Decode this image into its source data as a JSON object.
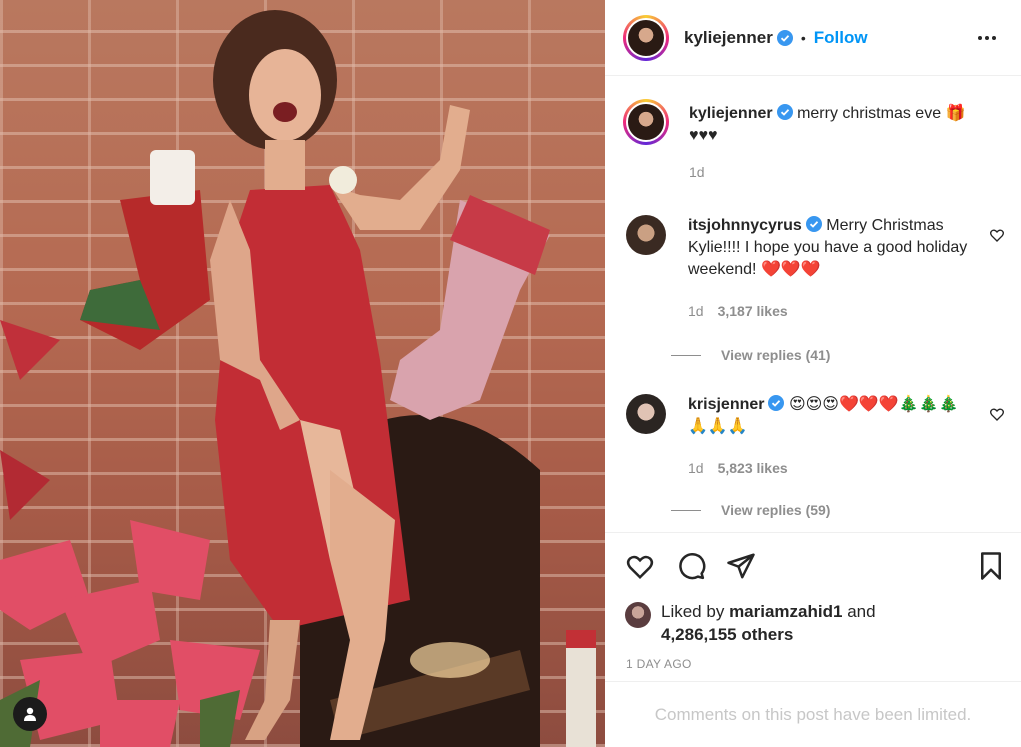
{
  "post": {
    "username": "kyliejenner",
    "follow_label": "Follow",
    "separator": "•",
    "caption": "merry christmas eve 🎁",
    "caption_line2": "♥♥♥",
    "caption_time": "1d"
  },
  "comments": [
    {
      "username": "itsjohnnycyrus",
      "text": "Merry Christmas Kylie!!!! I hope you have a good holiday weekend! ❤️❤️❤️",
      "time": "1d",
      "likes": "3,187 likes",
      "replies": "View replies (41)"
    },
    {
      "username": "krisjenner",
      "text": "😍😍😍❤️❤️❤️🎄🎄🎄🙏🙏🙏",
      "time": "1d",
      "likes": "5,823 likes",
      "replies": "View replies (59)"
    }
  ],
  "liked_by": {
    "prefix": "Liked by",
    "user": "mariamzahid1",
    "joiner": "and",
    "others": "4,286,155 others"
  },
  "posted_ago": "1 DAY AGO",
  "comments_limited": "Comments on this post have been limited.",
  "colors": {
    "accent": "#0095f6",
    "verified": "#3897f0",
    "heart_red": "#ed4956",
    "muted": "#8e8e8e"
  },
  "icons": [
    "verified-badge-icon",
    "more-options-icon",
    "heart-icon",
    "comment-icon",
    "share-icon",
    "bookmark-icon",
    "user-tag-icon"
  ]
}
